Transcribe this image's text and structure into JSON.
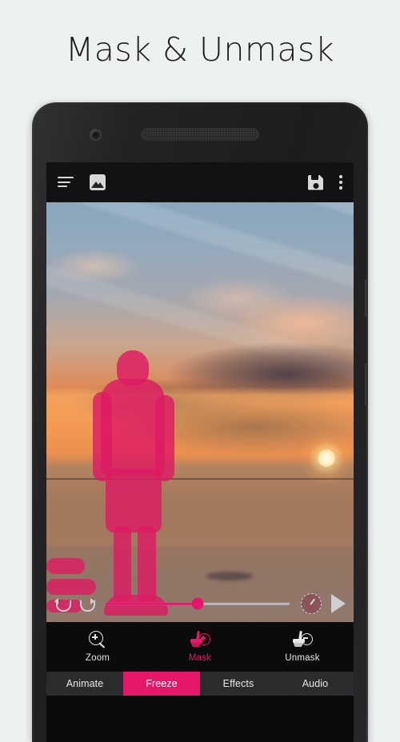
{
  "page": {
    "title": "Mask & Unmask",
    "background_color": "#eef1f2",
    "accent_color": "#e5176b"
  },
  "device": {
    "name": "android-phone-mockup",
    "front_camera": "front-camera",
    "earpiece": "earpiece-speaker",
    "side_buttons": [
      "power-button",
      "volume-rocker"
    ]
  },
  "app": {
    "appbar": {
      "menu_icon": "hamburger-menu-icon",
      "gallery_icon": "photo-gallery-icon",
      "save_icon": "save-floppy-icon",
      "overflow_icon": "more-vertical-icon"
    },
    "canvas": {
      "name": "video-preview",
      "description": "Sunset beach photo with a person standing at the waterline; person and foreground rocks are covered by a pink mask overlay",
      "mask_color": "#dd1b63"
    },
    "playback": {
      "undo_icon": "undo-icon",
      "redo_icon": "redo-icon",
      "speed_icon": "speed-dial-icon",
      "play_icon": "play-icon",
      "progress_percent": 50
    },
    "tools": [
      {
        "id": "zoom",
        "label": "Zoom",
        "icon": "zoom-magnifier-icon",
        "active": false
      },
      {
        "id": "mask",
        "label": "Mask",
        "icon": "brush-plus-icon",
        "active": true
      },
      {
        "id": "unmask",
        "label": "Unmask",
        "icon": "brush-minus-icon",
        "active": false
      }
    ],
    "tabs": [
      {
        "id": "animate",
        "label": "Animate",
        "active": false
      },
      {
        "id": "freeze",
        "label": "Freeze",
        "active": true
      },
      {
        "id": "effects",
        "label": "Effects",
        "active": false
      },
      {
        "id": "audio",
        "label": "Audio",
        "active": false
      }
    ]
  }
}
